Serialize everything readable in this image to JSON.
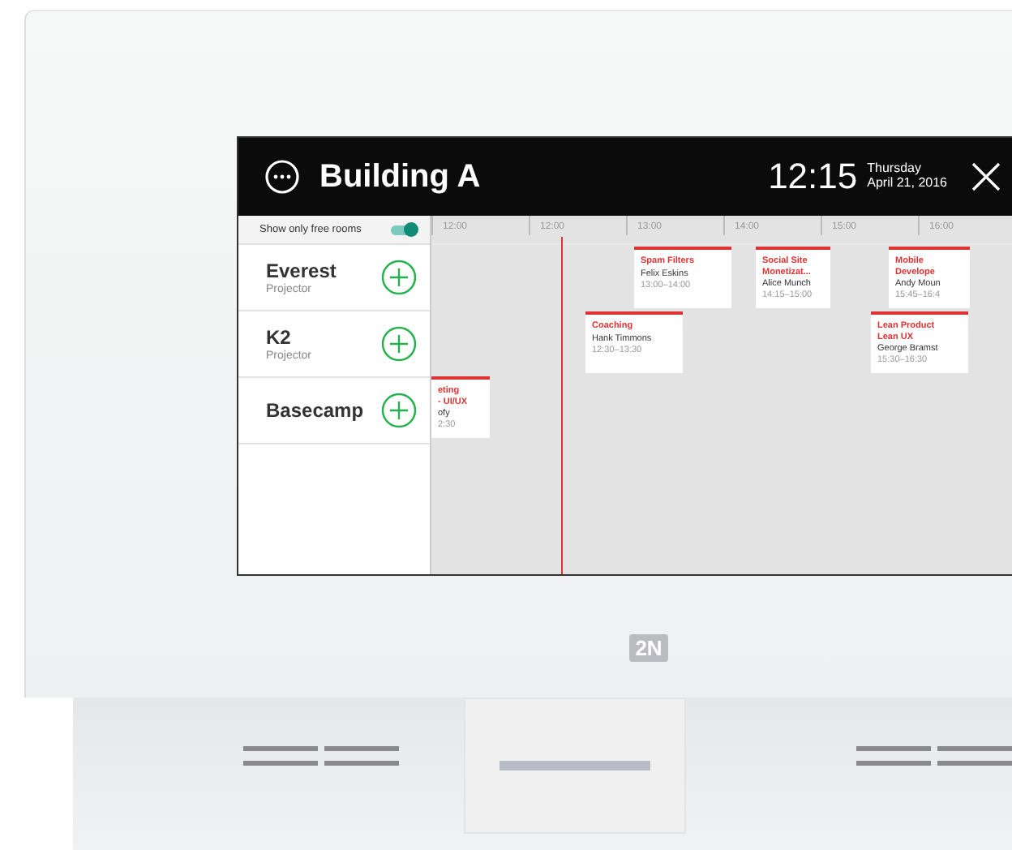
{
  "header": {
    "title": "Building A",
    "time": "12:15",
    "weekday": "Thursday",
    "date": "April 21, 2016"
  },
  "filter": {
    "label": "Show only free rooms",
    "on": true
  },
  "rooms": [
    {
      "name": "Everest",
      "feature": "Projector"
    },
    {
      "name": "K2",
      "feature": "Projector"
    },
    {
      "name": "Basecamp"
    }
  ],
  "hours": [
    "12:00",
    "12:00",
    "13:00",
    "14:00",
    "15:00",
    "16:00"
  ],
  "events": [
    {
      "title": [
        "eting",
        "- UI/UX"
      ],
      "person": "ofy",
      "time": "2:30"
    },
    {
      "title": [
        "Coaching"
      ],
      "person": "Hank Timmons",
      "time": "12:30–13:30"
    },
    {
      "title": [
        "Spam Filters"
      ],
      "person": "Felix Eskins",
      "time": "13:00–14:00"
    },
    {
      "title": [
        "Social Site",
        "Monetizat..."
      ],
      "person": "Alice Munch",
      "time": "14:15–15:00"
    },
    {
      "title": [
        "Mobile",
        "Develope"
      ],
      "person": "Andy Moun",
      "time": "15:45–16:4"
    },
    {
      "title": [
        "Lean Product",
        "Lean UX"
      ],
      "person": "George Bramst",
      "time": "15:30–16:30"
    }
  ],
  "device": {
    "logo": "2N"
  }
}
